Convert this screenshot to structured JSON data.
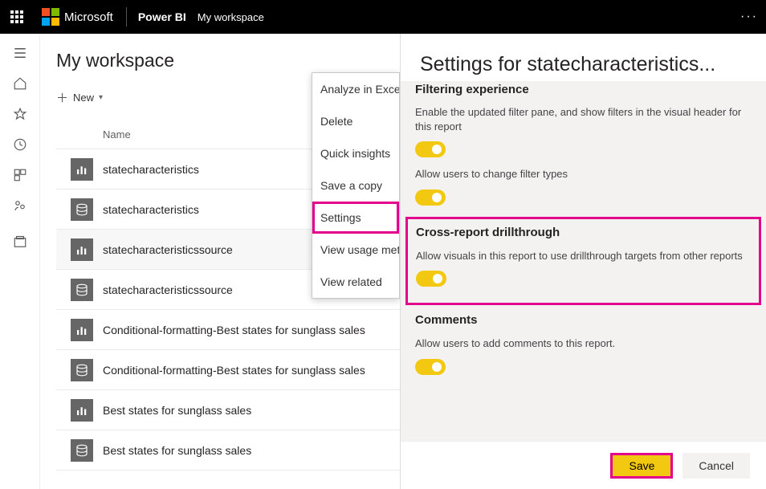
{
  "topbar": {
    "ms": "Microsoft",
    "pbi": "Power BI",
    "workspace": "My workspace",
    "dots": "···"
  },
  "main": {
    "title": "My workspace",
    "new_label": "New",
    "col_name": "Name",
    "row_type": "Report"
  },
  "items": [
    {
      "name": "statecharacteristics",
      "icon": "report"
    },
    {
      "name": "statecharacteristics",
      "icon": "dataset"
    },
    {
      "name": "statecharacteristicssource",
      "icon": "report",
      "hovered": true
    },
    {
      "name": "statecharacteristicssource",
      "icon": "dataset"
    },
    {
      "name": "Conditional-formatting-Best states for sunglass sales",
      "icon": "report"
    },
    {
      "name": "Conditional-formatting-Best states for sunglass sales",
      "icon": "dataset"
    },
    {
      "name": "Best states for sunglass sales",
      "icon": "report"
    },
    {
      "name": "Best states for sunglass sales",
      "icon": "dataset"
    }
  ],
  "ctx": {
    "analyze": "Analyze in Excel",
    "delete": "Delete",
    "insights": "Quick insights",
    "save_copy": "Save a copy",
    "settings": "Settings",
    "usage": "View usage metrics",
    "related": "View related"
  },
  "panel": {
    "title": "Settings for statecharacteristics...",
    "filtering_head": "Filtering experience",
    "filtering_desc": "Enable the updated filter pane, and show filters in the visual header for this report",
    "filter_types_desc": "Allow users to change filter types",
    "cross_head": "Cross-report drillthrough",
    "cross_desc": "Allow visuals in this report to use drillthrough targets from other reports",
    "comments_head": "Comments",
    "comments_desc": "Allow users to add comments to this report.",
    "save": "Save",
    "cancel": "Cancel"
  }
}
